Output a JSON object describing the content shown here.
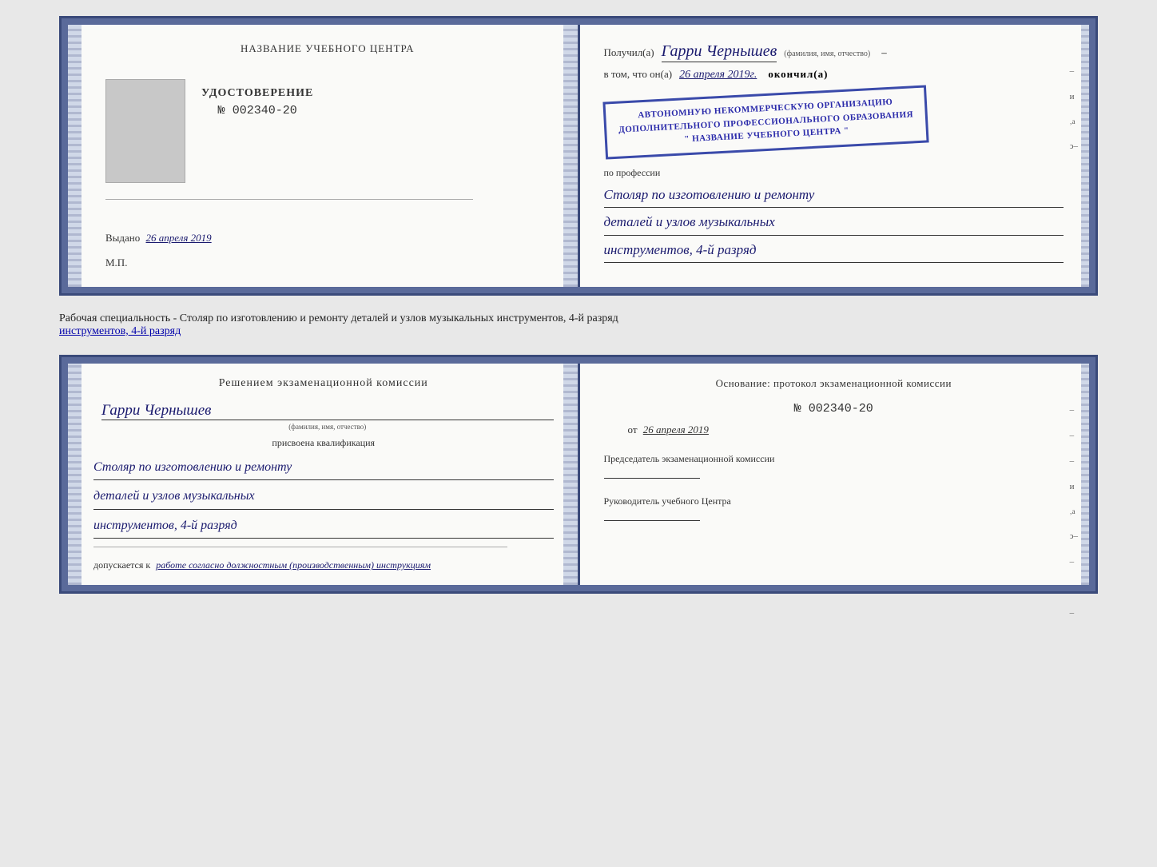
{
  "top_certificate": {
    "left": {
      "center_title": "НАЗВАНИЕ УЧЕБНОГО ЦЕНТРА",
      "photo_alt": "фото",
      "udostoverenie_label": "УДОСТОВЕРЕНИЕ",
      "number_prefix": "№",
      "number": "002340-20",
      "vydano_label": "Выдано",
      "vydano_date": "26 апреля 2019",
      "mp": "М.П."
    },
    "right": {
      "poluchil_prefix": "Получил(а)",
      "recipient_name": "Гарри Чернышев",
      "fio_hint": "(фамилия, имя, отчество)",
      "vtom_prefix": "в том, что он(а)",
      "vtom_date": "26 апреля 2019г.",
      "okonchil": "окончил(а)",
      "stamp_line1": "АВТОНОМНУЮ НЕКОММЕРЧЕСКУЮ ОРГАНИЗАЦИЮ",
      "stamp_line2": "ДОПОЛНИТЕЛЬНОГО ПРОФЕССИОНАЛЬНОГО ОБРАЗОВАНИЯ",
      "stamp_line3": "\" НАЗВАНИЕ УЧЕБНОГО ЦЕНТРА \"",
      "po_professii": "по профессии",
      "profession_line1": "Столяр по изготовлению и ремонту",
      "profession_line2": "деталей и узлов музыкальных",
      "profession_line3": "инструментов, 4-й разряд"
    }
  },
  "description": "Рабочая специальность - Столяр по изготовлению и ремонту деталей и узлов музыкальных инструментов, 4-й разряд",
  "bottom_certificate": {
    "left": {
      "resheniem_title": "Решением  экзаменационной  комиссии",
      "person_name": "Гарри Чернышев",
      "fio_hint": "(фамилия, имя, отчество)",
      "prisvoyena": "присвоена квалификация",
      "profession_line1": "Столяр по изготовлению и ремонту",
      "profession_line2": "деталей и узлов музыкальных",
      "profession_line3": "инструментов, 4-й разряд",
      "dopuskaetsya_prefix": "допускается к",
      "dopuskaetsya_text": "работе согласно должностным (производственным) инструкциям"
    },
    "right": {
      "osnovanie_title": "Основание: протокол экзаменационной  комиссии",
      "number_prefix": "№",
      "number": "002340-20",
      "ot_prefix": "от",
      "ot_date": "26 апреля 2019",
      "predsedatel_label": "Председатель экзаменационной комиссии",
      "rukovoditel_label": "Руководитель учебного Центра"
    }
  }
}
